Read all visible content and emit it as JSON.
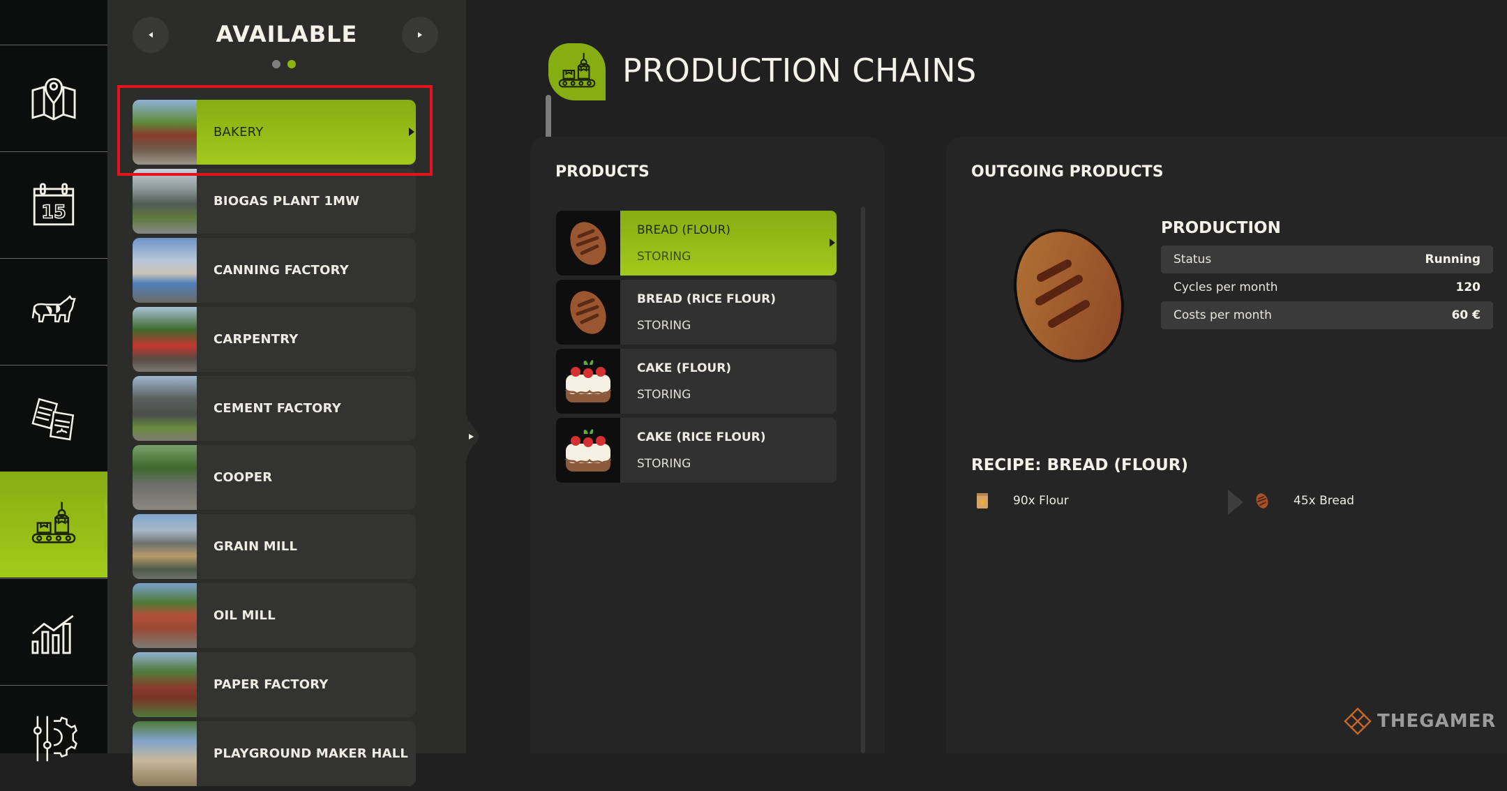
{
  "nav_rail": {
    "items": [
      {
        "id": "map",
        "icon": "map-icon",
        "active": false
      },
      {
        "id": "calendar",
        "icon": "calendar-icon",
        "calendar_day": "15",
        "active": false
      },
      {
        "id": "animals",
        "icon": "cow-icon",
        "active": false
      },
      {
        "id": "contracts",
        "icon": "documents-icon",
        "active": false
      },
      {
        "id": "production",
        "icon": "production-conveyor-icon",
        "active": true
      },
      {
        "id": "statistics",
        "icon": "bar-chart-icon",
        "active": false
      },
      {
        "id": "settings",
        "icon": "settings-sliders-gear-icon",
        "active": false
      }
    ]
  },
  "available": {
    "title": "AVAILABLE",
    "page_dots": 2,
    "active_page": 2,
    "items": [
      {
        "label": "BAKERY",
        "selected": true
      },
      {
        "label": "BIOGAS PLANT 1MW",
        "selected": false
      },
      {
        "label": "CANNING FACTORY",
        "selected": false
      },
      {
        "label": "CARPENTRY",
        "selected": false
      },
      {
        "label": "CEMENT FACTORY",
        "selected": false
      },
      {
        "label": "COOPER",
        "selected": false
      },
      {
        "label": "GRAIN MILL",
        "selected": false
      },
      {
        "label": "OIL MILL",
        "selected": false
      },
      {
        "label": "PAPER FACTORY",
        "selected": false
      },
      {
        "label": "PLAYGROUND MAKER HALL",
        "selected": false
      }
    ],
    "scroll_fraction_visible": 0.58
  },
  "main": {
    "title": "PRODUCTION CHAINS",
    "accent_color": "#8db414",
    "products": {
      "title": "PRODUCTS",
      "items": [
        {
          "name": "BREAD (FLOUR)",
          "status": "STORING",
          "icon": "bread",
          "selected": true
        },
        {
          "name": "BREAD (RICE FLOUR)",
          "status": "STORING",
          "icon": "bread",
          "selected": false
        },
        {
          "name": "CAKE (FLOUR)",
          "status": "STORING",
          "icon": "cake",
          "selected": false
        },
        {
          "name": "CAKE (RICE FLOUR)",
          "status": "STORING",
          "icon": "cake",
          "selected": false
        }
      ]
    },
    "outgoing": {
      "title": "OUTGOING PRODUCTS",
      "production": {
        "title": "PRODUCTION",
        "rows": [
          {
            "label": "Status",
            "value": "Running"
          },
          {
            "label": "Cycles per month",
            "value": "120"
          },
          {
            "label": "Costs per month",
            "value": "60 €"
          }
        ]
      },
      "recipe": {
        "title": "RECIPE: BREAD (FLOUR)",
        "input": {
          "text": "90x Flour",
          "icon": "flour-sack-icon"
        },
        "output": {
          "text": "45x Bread",
          "icon": "bread-icon"
        }
      }
    }
  },
  "watermark": {
    "text": "THEGAMER"
  },
  "highlight_color": "#e5141a"
}
